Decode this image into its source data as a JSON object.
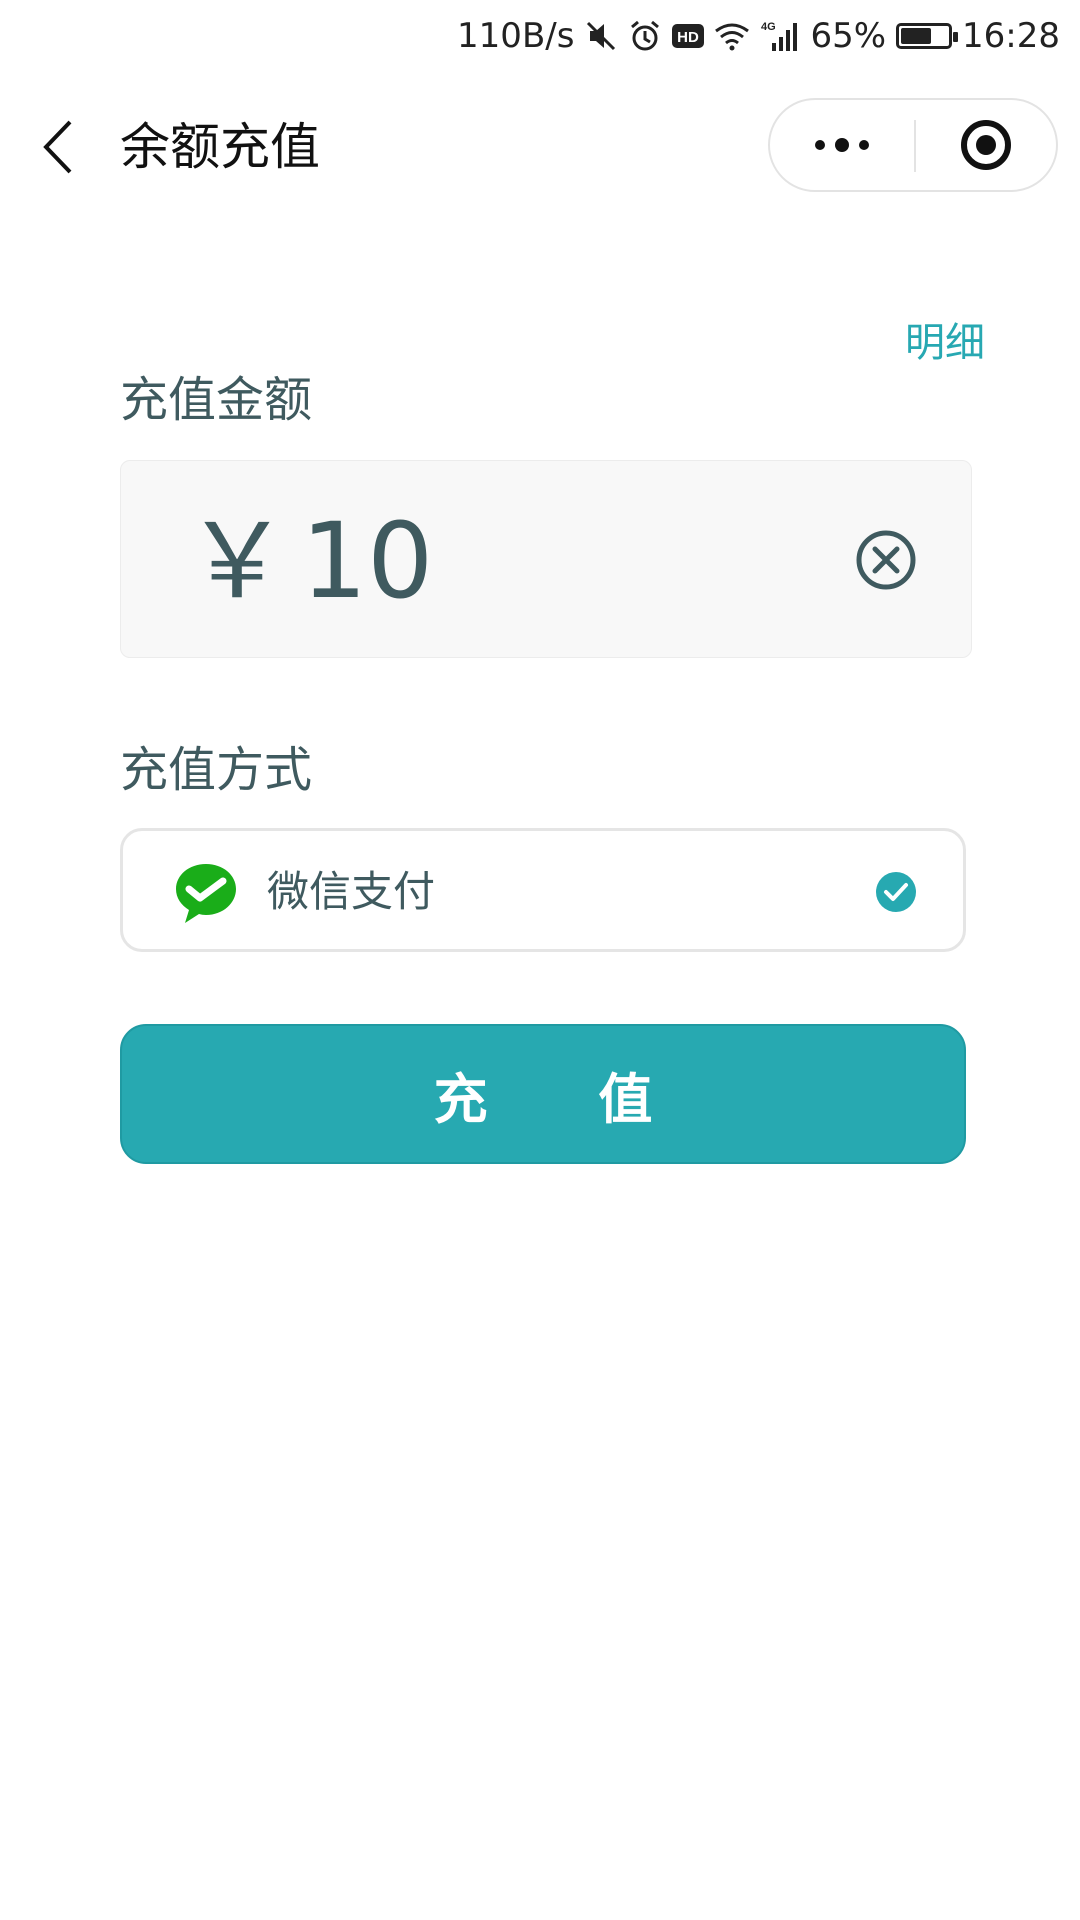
{
  "status_bar": {
    "net_speed": "110B/s",
    "battery_percent": "65%",
    "battery_level": 0.65,
    "time": "16:28",
    "signal_label": "4G",
    "icons": [
      "mute-icon",
      "alarm-icon",
      "hd-icon",
      "wifi-icon",
      "signal-icon",
      "battery-icon"
    ]
  },
  "nav": {
    "title": "余额充值",
    "icons": [
      "back-icon",
      "more-icon",
      "close-miniprogram-icon"
    ]
  },
  "detail_link": "明细",
  "amount": {
    "label": "充值金额",
    "currency": "￥",
    "value": "10",
    "clear_icon": "clear-circle-icon"
  },
  "payment": {
    "label": "充值方式",
    "method_label": "微信支付",
    "method_icon": "wechat-pay-icon",
    "selected": true
  },
  "submit_label": "充 值",
  "colors": {
    "accent": "#27a9b1",
    "text_muted": "#3f5a5f",
    "wechat_green": "#1aad19"
  }
}
